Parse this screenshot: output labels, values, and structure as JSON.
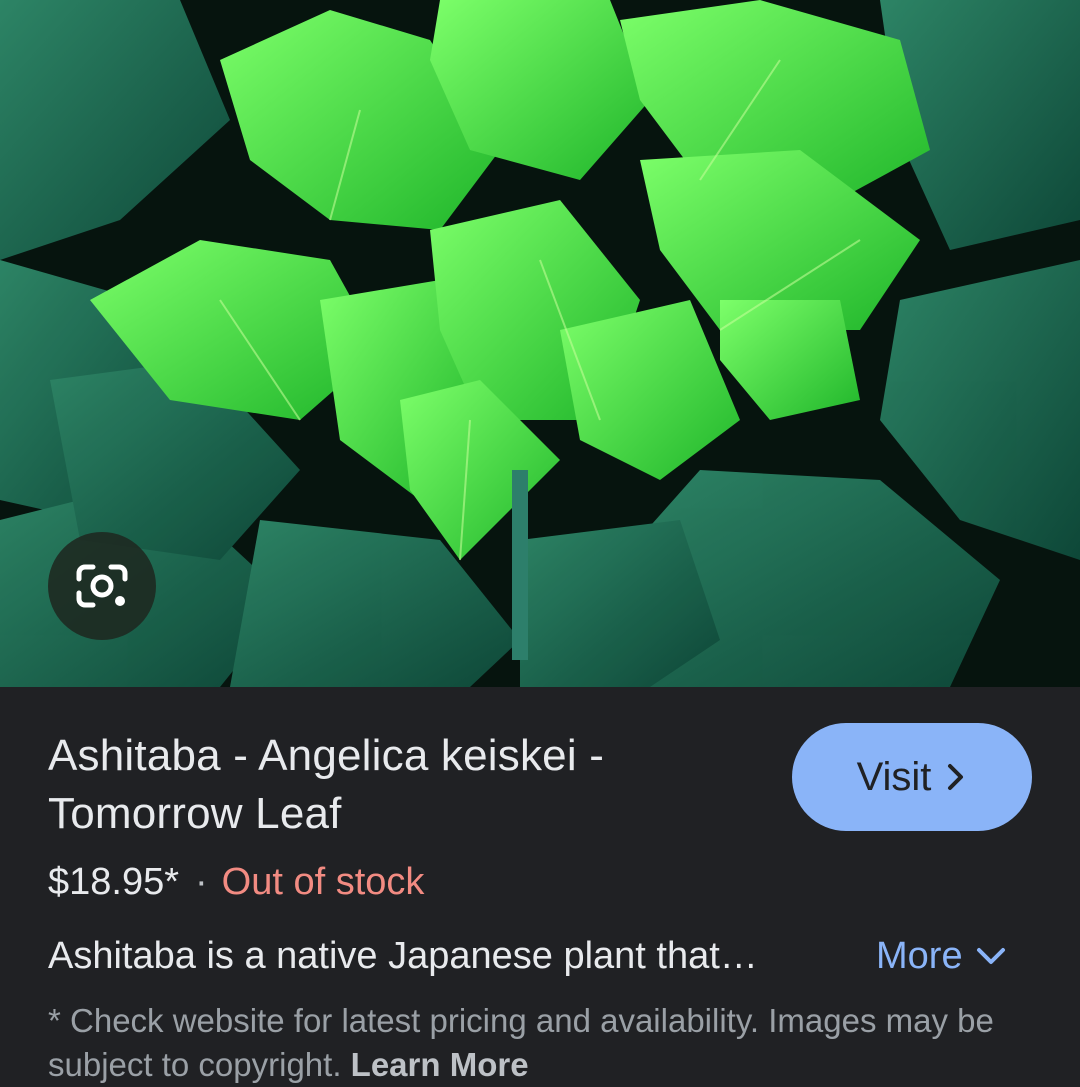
{
  "image": {
    "subject": "ashitaba-leaves",
    "lens_button_icon": "google-lens-icon"
  },
  "result": {
    "title": "Ashitaba - Angelica keiskei - Tomorrow Leaf",
    "visit_label": "Visit",
    "visit_icon": "chevron-right-icon",
    "price": "$18.95*",
    "separator": "·",
    "stock_status": "Out of stock",
    "description": "Ashitaba is a native Japanese plant that…",
    "more_label": "More",
    "more_icon": "chevron-down-icon",
    "disclaimer": "* Check website for latest pricing and availability. Images may be subject to copyright.",
    "learn_more_label": "Learn More"
  },
  "colors": {
    "background": "#202124",
    "accent": "#8ab4f8",
    "stock_status": "#f28b82",
    "text_primary": "#e8eaed",
    "text_secondary": "#9aa0a6"
  }
}
